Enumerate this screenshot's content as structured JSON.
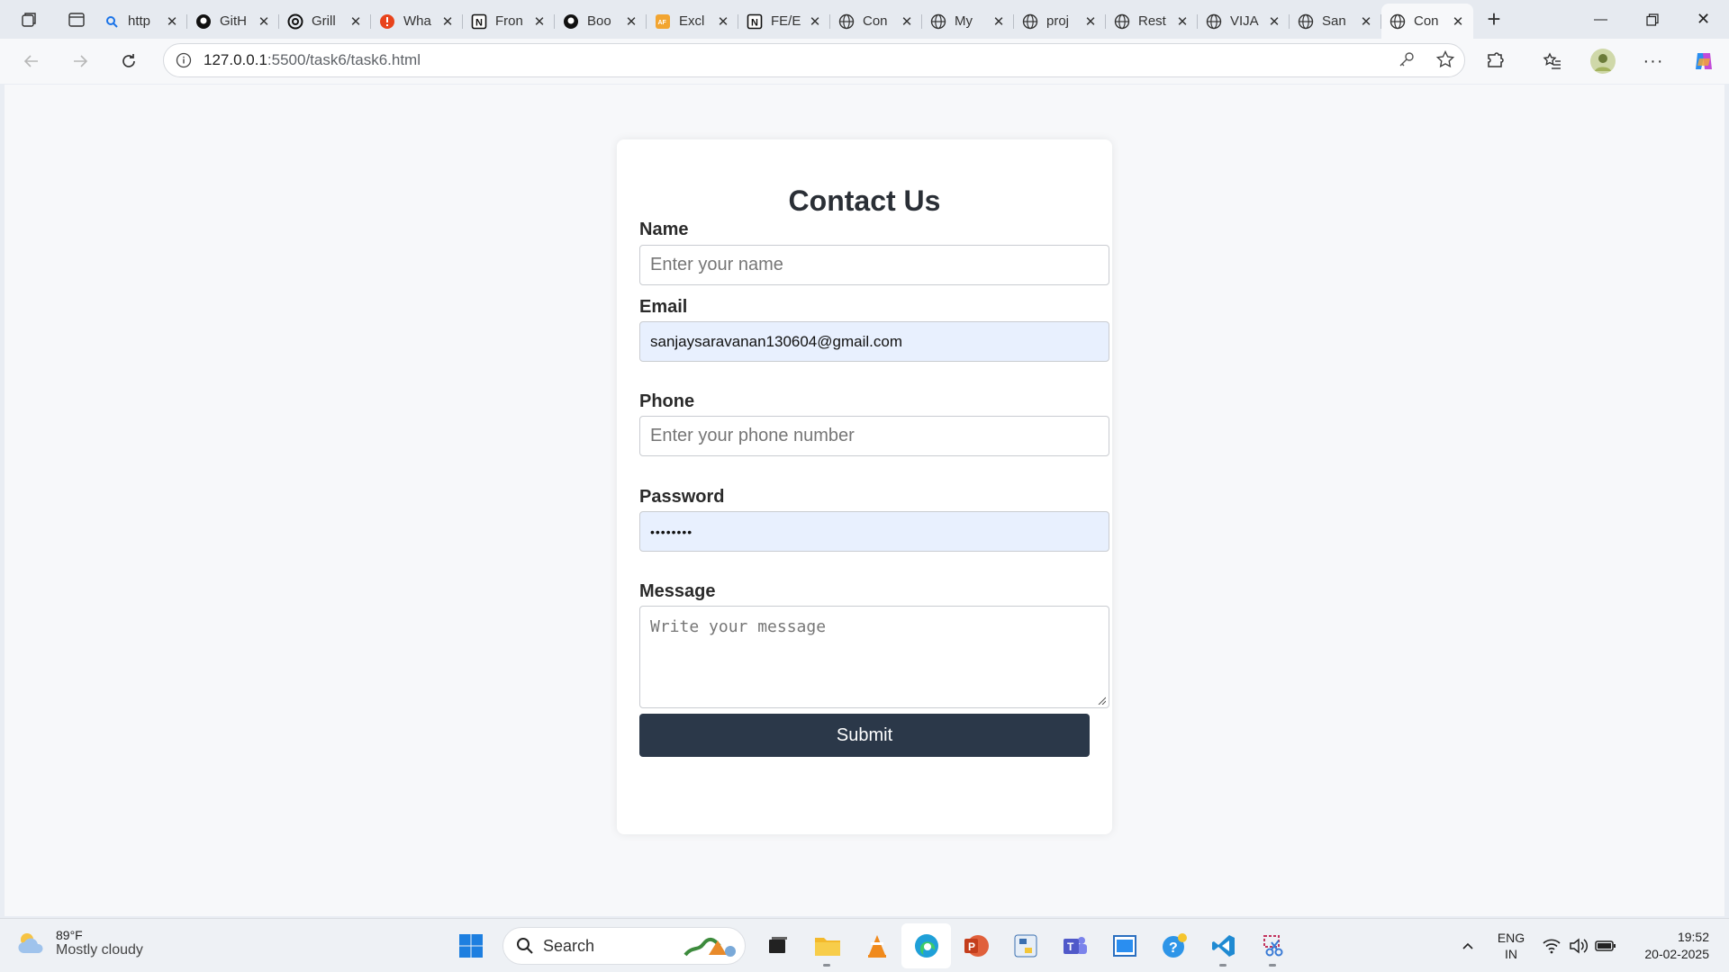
{
  "browser": {
    "tabs": [
      {
        "title": "http"
      },
      {
        "title": "GitH"
      },
      {
        "title": "Grill"
      },
      {
        "title": "Wha"
      },
      {
        "title": "Fron"
      },
      {
        "title": "Boo"
      },
      {
        "title": "Excl"
      },
      {
        "title": "FE/E"
      },
      {
        "title": "Con"
      },
      {
        "title": "My"
      },
      {
        "title": "proj"
      },
      {
        "title": "Rest"
      },
      {
        "title": "VIJA"
      },
      {
        "title": "San"
      },
      {
        "title": "Con"
      }
    ],
    "url_host": "127.0.0.1",
    "url_rest": ":5500/task6/task6.html"
  },
  "form": {
    "title": "Contact Us",
    "name_label": "Name",
    "name_placeholder": "Enter your name",
    "email_label": "Email",
    "email_value": "sanjaysaravanan130604@gmail.com",
    "phone_label": "Phone",
    "phone_placeholder": "Enter your phone number",
    "password_label": "Password",
    "password_value": "••••••••",
    "message_label": "Message",
    "message_placeholder": "Write your message",
    "submit_label": "Submit"
  },
  "taskbar": {
    "weather_temp": "89°F",
    "weather_desc": "Mostly cloudy",
    "search_label": "Search",
    "lang_line1": "ENG",
    "lang_line2": "IN",
    "time": "19:52",
    "date": "20-02-2025"
  }
}
